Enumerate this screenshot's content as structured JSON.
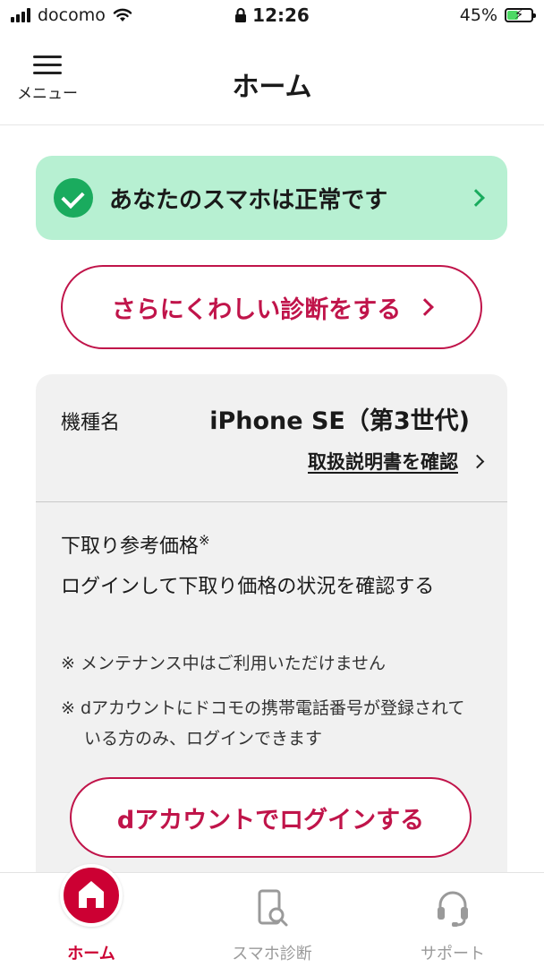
{
  "status_bar": {
    "carrier": "docomo",
    "time": "12:26",
    "battery_percent": "45%",
    "battery_level": 0.45
  },
  "header": {
    "menu_label": "メニュー",
    "title": "ホーム"
  },
  "status_card": {
    "text": "あなたのスマホは正常です",
    "color": "#b7f0d2",
    "icon": "check-circle-icon"
  },
  "diagnose_button": {
    "label": "さらにくわしい診断をする"
  },
  "device_card": {
    "model_label": "機種名",
    "model_value": "iPhone SE（第3世代)",
    "manual_link": "取扱説明書を確認",
    "tradein_label": "下取り参考価格",
    "tradein_mark": "※",
    "tradein_desc": "ログインして下取り価格の状況を確認する",
    "note1": "※ メンテナンス中はご利用いただけません",
    "note2": "※ dアカウントにドコモの携帯電話番号が登録されている方のみ、ログインできます",
    "login_button": "dアカウントでログインする"
  },
  "bottom_nav": {
    "items": [
      {
        "label": "ホーム",
        "icon": "home-icon",
        "active": true
      },
      {
        "label": "スマホ診断",
        "icon": "phone-search-icon",
        "active": false
      },
      {
        "label": "サポート",
        "icon": "headset-icon",
        "active": false
      }
    ]
  },
  "colors": {
    "accent": "#cc0033",
    "success": "#1aab5e"
  }
}
